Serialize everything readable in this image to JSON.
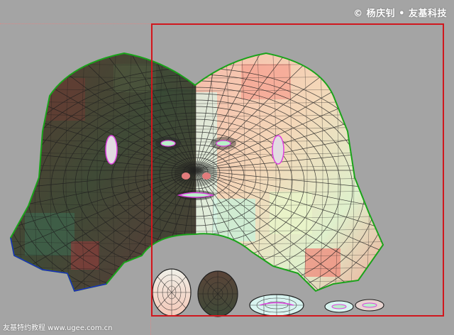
{
  "watermark": {
    "text": "© 杨庆钊 • 友基科技",
    "color": "#ffffff"
  },
  "footer": {
    "text": "友基特约教程 www.ugee.com.cn",
    "color": "#ffffff"
  },
  "colors": {
    "background": "#a4a4a4",
    "uv_bounds_border": "#d0171d",
    "seam_edge": "#1aa31a",
    "wire": "#1f1f1f",
    "left_shell_dark": "#4a3a30",
    "right_shell_light": "#f4cfb6",
    "selection": "#e040e0"
  },
  "icons": [
    "copyright-icon"
  ]
}
